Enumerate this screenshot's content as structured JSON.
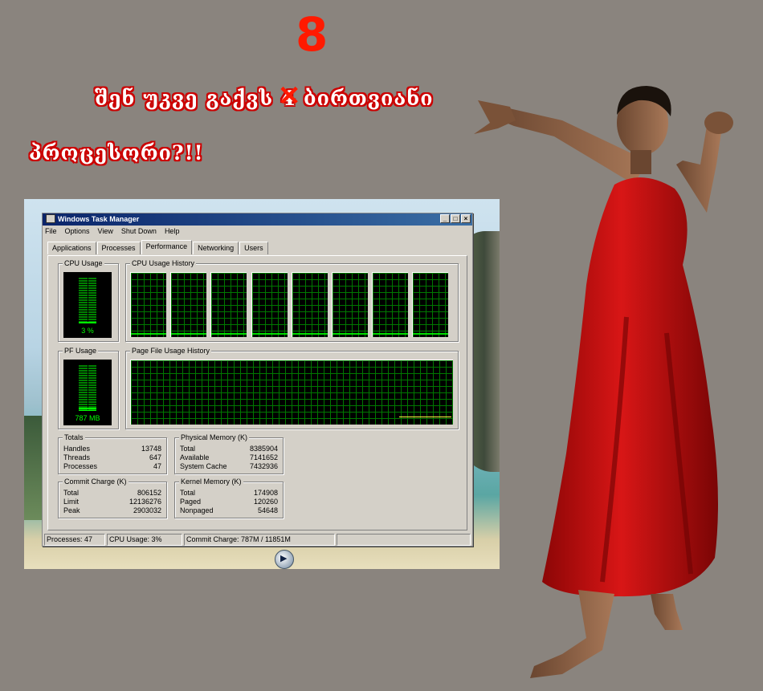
{
  "overlay": {
    "number": "8",
    "headline_part1": "შენ უკვე გაქვს ",
    "struck_digit": "4",
    "headline_part2": " ბირთვიანი",
    "headline_line2": "პროცესორი?!!"
  },
  "window": {
    "title": "Windows Task Manager",
    "controls": [
      "_",
      "□",
      "×"
    ],
    "menu": [
      "File",
      "Options",
      "View",
      "Shut Down",
      "Help"
    ],
    "tabs": [
      "Applications",
      "Processes",
      "Performance",
      "Networking",
      "Users"
    ],
    "active_tab": "Performance",
    "cpu_usage": {
      "title": "CPU Usage",
      "value": "3 %",
      "percent": 3
    },
    "cpu_history": {
      "title": "CPU Usage History",
      "cores": 8
    },
    "pf_usage": {
      "title": "PF Usage",
      "value": "787 MB",
      "fraction": 0.07
    },
    "pf_history": {
      "title": "Page File Usage History"
    },
    "totals": {
      "title": "Totals",
      "rows": [
        [
          "Handles",
          "13748"
        ],
        [
          "Threads",
          "647"
        ],
        [
          "Processes",
          "47"
        ]
      ]
    },
    "physical": {
      "title": "Physical Memory (K)",
      "rows": [
        [
          "Total",
          "8385904"
        ],
        [
          "Available",
          "7141652"
        ],
        [
          "System Cache",
          "7432936"
        ]
      ]
    },
    "commit": {
      "title": "Commit Charge (K)",
      "rows": [
        [
          "Total",
          "806152"
        ],
        [
          "Limit",
          "12136276"
        ],
        [
          "Peak",
          "2903032"
        ]
      ]
    },
    "kernel": {
      "title": "Kernel Memory (K)",
      "rows": [
        [
          "Total",
          "174908"
        ],
        [
          "Paged",
          "120260"
        ],
        [
          "Nonpaged",
          "54648"
        ]
      ]
    },
    "status": {
      "processes": "Processes: 47",
      "cpu": "CPU Usage: 3%",
      "commit": "Commit Charge: 787M / 11851M"
    }
  },
  "colors": {
    "meter_on": "#00ff00",
    "grid": "#007800",
    "headline_red": "#ff1a00",
    "dress_red": "#c40d0d"
  }
}
